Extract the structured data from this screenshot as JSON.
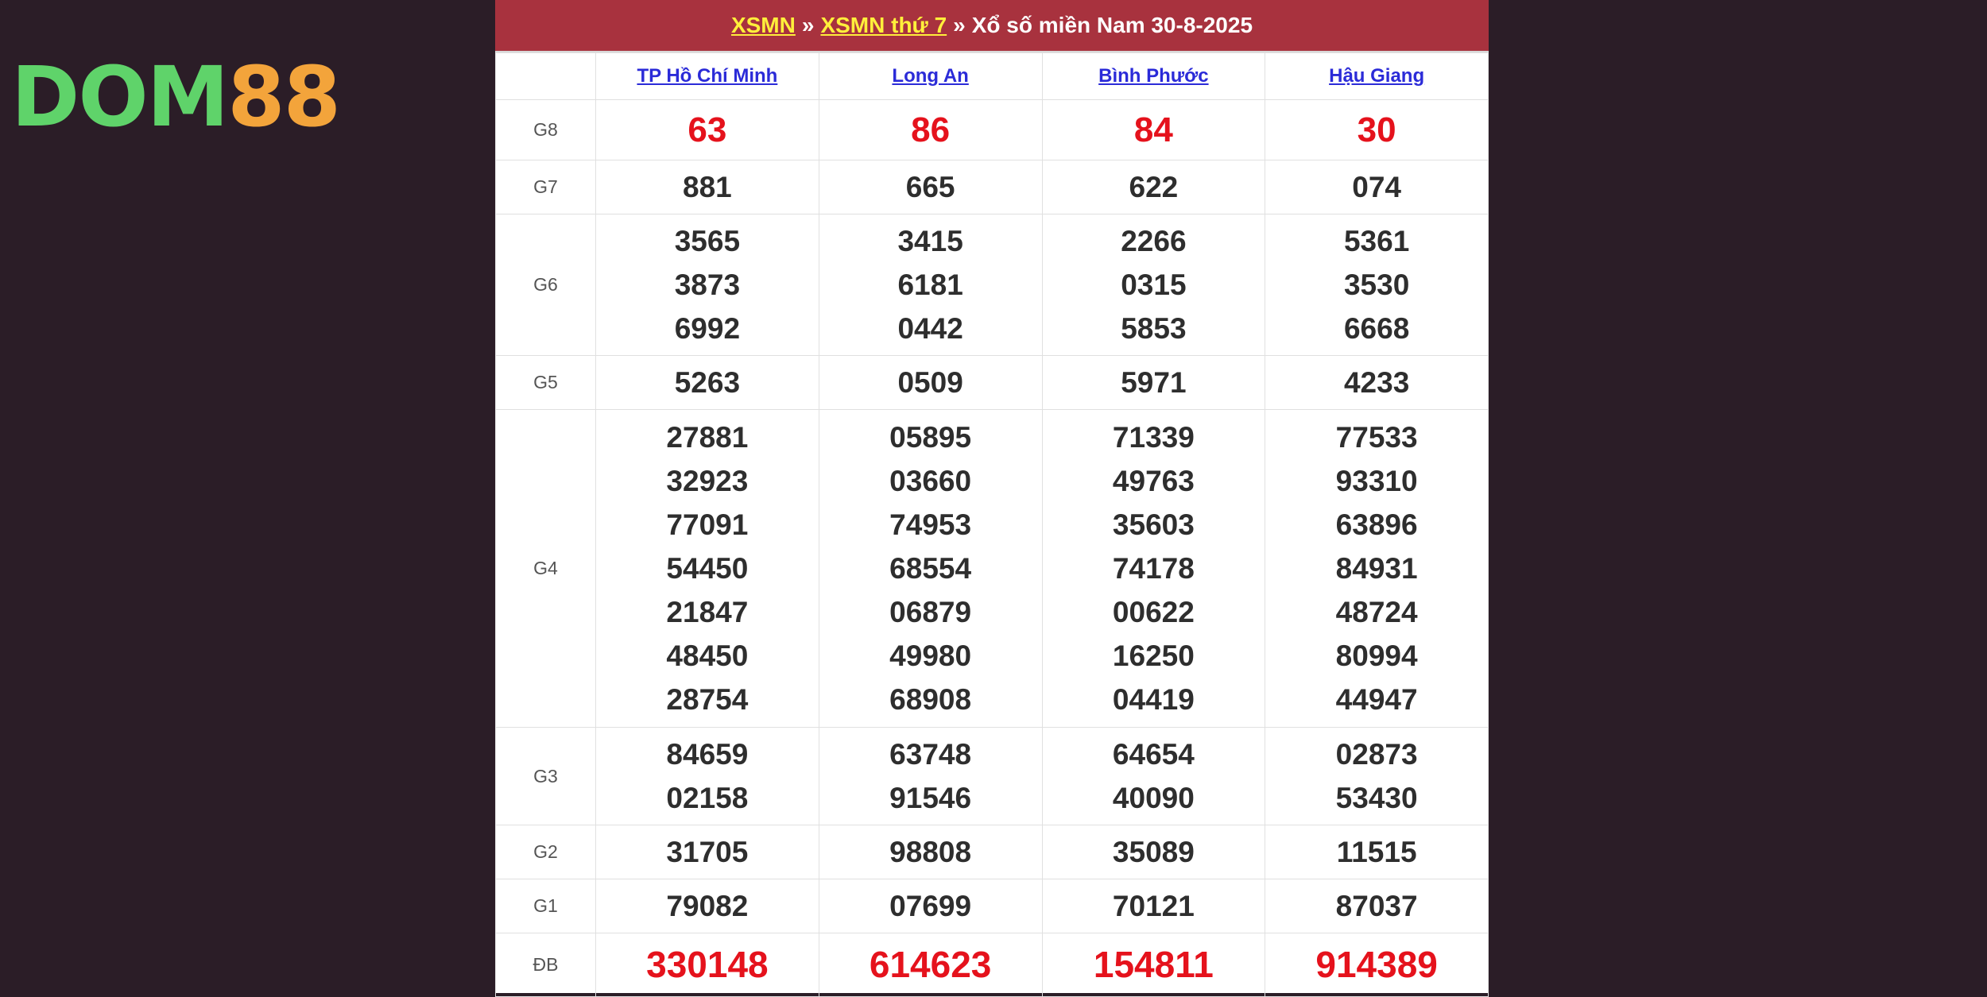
{
  "logo": {
    "part1": "DOM",
    "part2": "88"
  },
  "header": {
    "link1": "XSMN",
    "sep1": "»",
    "link2": "XSMN thứ 7",
    "sep2": "»",
    "rest": "Xổ số miền Nam 30-8-2025"
  },
  "provinces": [
    "TP Hồ Chí Minh",
    "Long An",
    "Bình Phước",
    "Hậu Giang"
  ],
  "rows": {
    "g8": {
      "label": "G8",
      "values": [
        [
          "63"
        ],
        [
          "86"
        ],
        [
          "84"
        ],
        [
          "30"
        ]
      ]
    },
    "g7": {
      "label": "G7",
      "values": [
        [
          "881"
        ],
        [
          "665"
        ],
        [
          "622"
        ],
        [
          "074"
        ]
      ]
    },
    "g6": {
      "label": "G6",
      "values": [
        [
          "3565",
          "3873",
          "6992"
        ],
        [
          "3415",
          "6181",
          "0442"
        ],
        [
          "2266",
          "0315",
          "5853"
        ],
        [
          "5361",
          "3530",
          "6668"
        ]
      ]
    },
    "g5": {
      "label": "G5",
      "values": [
        [
          "5263"
        ],
        [
          "0509"
        ],
        [
          "5971"
        ],
        [
          "4233"
        ]
      ]
    },
    "g4": {
      "label": "G4",
      "values": [
        [
          "27881",
          "32923",
          "77091",
          "54450",
          "21847",
          "48450",
          "28754"
        ],
        [
          "05895",
          "03660",
          "74953",
          "68554",
          "06879",
          "49980",
          "68908"
        ],
        [
          "71339",
          "49763",
          "35603",
          "74178",
          "00622",
          "16250",
          "04419"
        ],
        [
          "77533",
          "93310",
          "63896",
          "84931",
          "48724",
          "80994",
          "44947"
        ]
      ]
    },
    "g3": {
      "label": "G3",
      "values": [
        [
          "84659",
          "02158"
        ],
        [
          "63748",
          "91546"
        ],
        [
          "64654",
          "40090"
        ],
        [
          "02873",
          "53430"
        ]
      ]
    },
    "g2": {
      "label": "G2",
      "values": [
        [
          "31705"
        ],
        [
          "98808"
        ],
        [
          "35089"
        ],
        [
          "11515"
        ]
      ]
    },
    "g1": {
      "label": "G1",
      "values": [
        [
          "79082"
        ],
        [
          "07699"
        ],
        [
          "70121"
        ],
        [
          "87037"
        ]
      ]
    },
    "db": {
      "label": "ĐB",
      "values": [
        [
          "330148"
        ],
        [
          "614623"
        ],
        [
          "154811"
        ],
        [
          "914389"
        ]
      ]
    }
  },
  "colors": {
    "title_bg": "#a8323e",
    "link_yellow": "#ffef3b",
    "prize_red": "#e5121c",
    "page_bg": "#2b1d27"
  }
}
